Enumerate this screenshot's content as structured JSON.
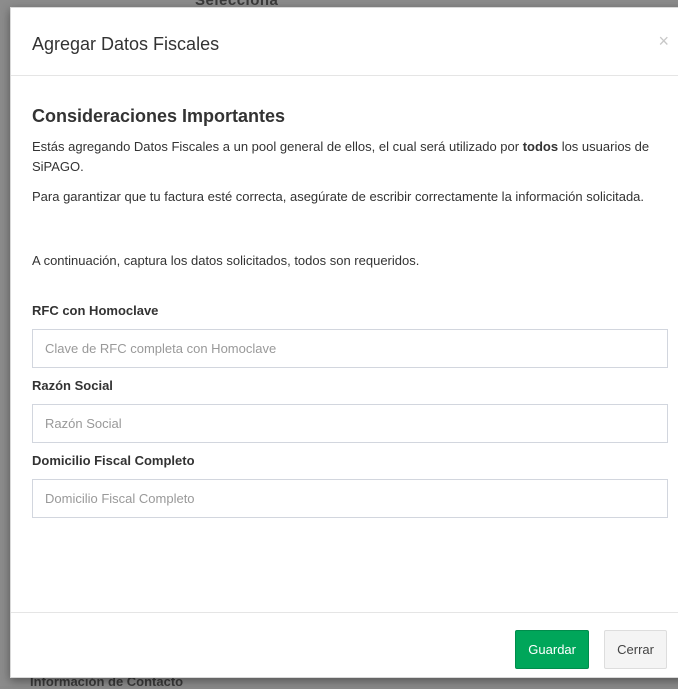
{
  "background": {
    "top_text": "Selecciona",
    "bottom_text": "Información de Contacto"
  },
  "modal": {
    "title": "Agregar Datos Fiscales",
    "close_symbol": "×",
    "section_title": "Consideraciones Importantes",
    "para1_before": "Estás agregando Datos Fiscales a un pool general de ellos, el cual será utilizado por ",
    "para1_bold": "todos",
    "para1_after": " los usuarios de SiPAGO.",
    "para2": "Para garantizar que tu factura esté correcta, asegúrate de escribir correctamente la información solicitada.",
    "intro": "A continuación, captura los datos solicitados, todos son requeridos.",
    "fields": {
      "rfc": {
        "label": "RFC con Homoclave",
        "placeholder": "Clave de RFC completa con Homoclave",
        "value": ""
      },
      "razon": {
        "label": "Razón Social",
        "placeholder": "Razón Social",
        "value": ""
      },
      "domicilio": {
        "label": "Domicilio Fiscal Completo",
        "placeholder": "Domicilio Fiscal Completo",
        "value": ""
      }
    },
    "buttons": {
      "save": "Guardar",
      "close": "Cerrar"
    }
  },
  "colors": {
    "save_button": "#00a65a",
    "close_button": "#f4f4f4"
  }
}
